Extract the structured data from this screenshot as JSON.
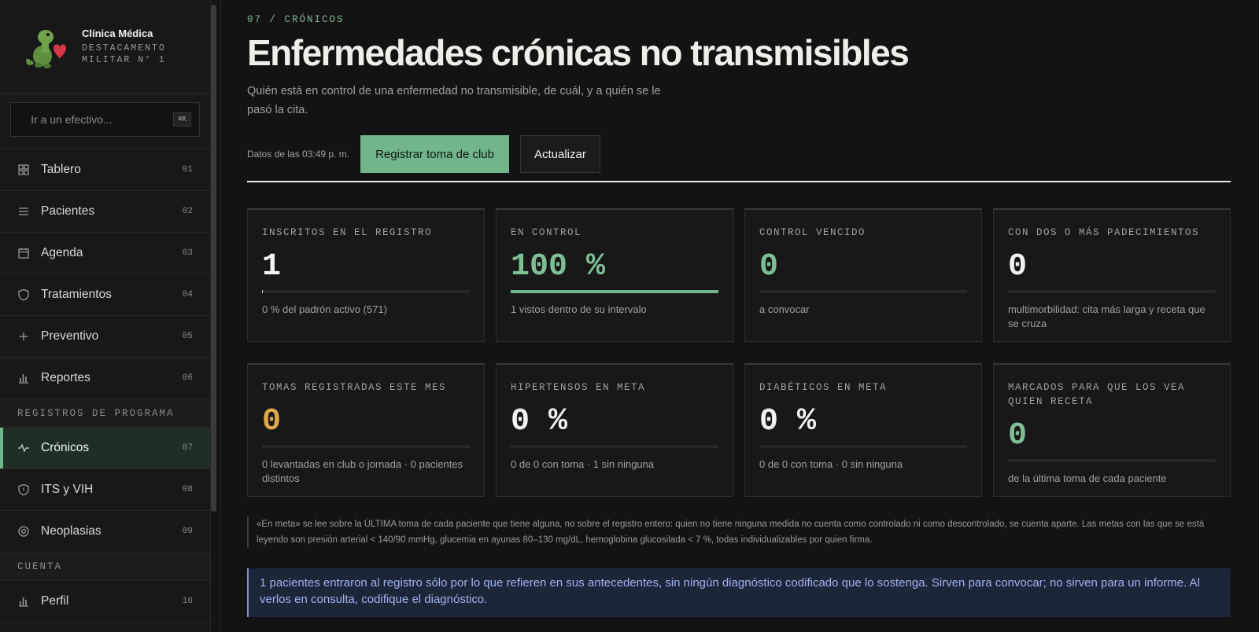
{
  "brand": {
    "name": "Clínica Médica",
    "subtitle": "DESTACAMENTO MILITAR N° 1"
  },
  "search": {
    "placeholder": "Ir a un efectivo...",
    "shortcut": "⌘K"
  },
  "nav": {
    "main": [
      {
        "label": "Tablero",
        "num": "01",
        "icon": "dashboard-icon"
      },
      {
        "label": "Pacientes",
        "num": "02",
        "icon": "list-icon"
      },
      {
        "label": "Agenda",
        "num": "03",
        "icon": "calendar-icon"
      },
      {
        "label": "Tratamientos",
        "num": "04",
        "icon": "shield-icon"
      },
      {
        "label": "Preventivo",
        "num": "05",
        "icon": "plus-icon"
      },
      {
        "label": "Reportes",
        "num": "06",
        "icon": "bar-chart-icon"
      }
    ],
    "section_programs": "REGISTROS DE PROGRAMA",
    "programs": [
      {
        "label": "Crónicos",
        "num": "07",
        "icon": "pulse-icon",
        "active": true
      },
      {
        "label": "ITS y VIH",
        "num": "08",
        "icon": "shield-check-icon"
      },
      {
        "label": "Neoplasias",
        "num": "09",
        "icon": "target-icon"
      }
    ],
    "section_account": "CUENTA",
    "account": [
      {
        "label": "Perfil",
        "num": "10",
        "icon": "bar-chart-icon"
      }
    ]
  },
  "page": {
    "breadcrumb": "07 / CRÓNICOS",
    "title": "Enfermedades crónicas no transmisibles",
    "subtitle": "Quién está en control de una enfermedad no transmisible, de cuál, y a quién se le pasó la cita.",
    "updated": "Datos de las 03:49 p. m.",
    "primary_button": "Registrar toma de club",
    "secondary_button": "Actualizar"
  },
  "kpis_row1": [
    {
      "label": "INSCRITOS EN EL REGISTRO",
      "value": "1",
      "note": "0 % del padrón activo (571)",
      "progress": 0.002,
      "style": "white"
    },
    {
      "label": "EN CONTROL",
      "value": "100 %",
      "note": "1 vistos dentro de su intervalo",
      "progress": 1.0,
      "style": "green"
    },
    {
      "label": "CONTROL VENCIDO",
      "value": "0",
      "note": "a convocar",
      "progress": 0,
      "style": "green"
    },
    {
      "label": "CON DOS O MÁS PADECIMIENTOS",
      "value": "0",
      "note": "multimorbilidad: cita más larga y receta que se cruza",
      "progress": 0,
      "style": "white"
    }
  ],
  "kpis_row2": [
    {
      "label": "TOMAS REGISTRADAS ESTE MES",
      "value": "0",
      "note": "0 levantadas en club o jornada · 0 pacientes distintos",
      "progress": 0,
      "style": "amber"
    },
    {
      "label": "HIPERTENSOS EN META",
      "value": "0 %",
      "note": "0 de 0 con toma · 1 sin ninguna",
      "progress": 0,
      "style": "white"
    },
    {
      "label": "DIABÉTICOS EN META",
      "value": "0 %",
      "note": "0 de 0 con toma · 0 sin ninguna",
      "progress": 0,
      "style": "white"
    },
    {
      "label": "MARCADOS PARA QUE LOS VEA QUIEN RECETA",
      "value": "0",
      "note": "de la última toma de cada paciente",
      "progress": 0,
      "style": "green"
    }
  ],
  "footnote": "«En meta» se lee sobre la ÚLTIMA toma de cada paciente que tiene alguna, no sobre el registro entero: quien no tiene ninguna medida no cuenta como controlado ni como descontrolado, se cuenta aparte. Las metas con las que se está leyendo son presión arterial < 140/90 mmHg, glucemia en ayunas 80–130 mg/dL, hemoglobina glucosilada < 7 %, todas individualizables por quien firma.",
  "notice": "1 pacientes entraron al registro sólo por lo que refieren en sus antecedentes, sin ningún diagnóstico codificado que lo sostenga. Sirven para convocar; no sirven para un informe. Al verlos en consulta, codifique el diagnóstico.",
  "colors": {
    "accent_green": "#72b58b",
    "amber": "#e0a84e",
    "notice_blue": "#9fb3ee"
  }
}
